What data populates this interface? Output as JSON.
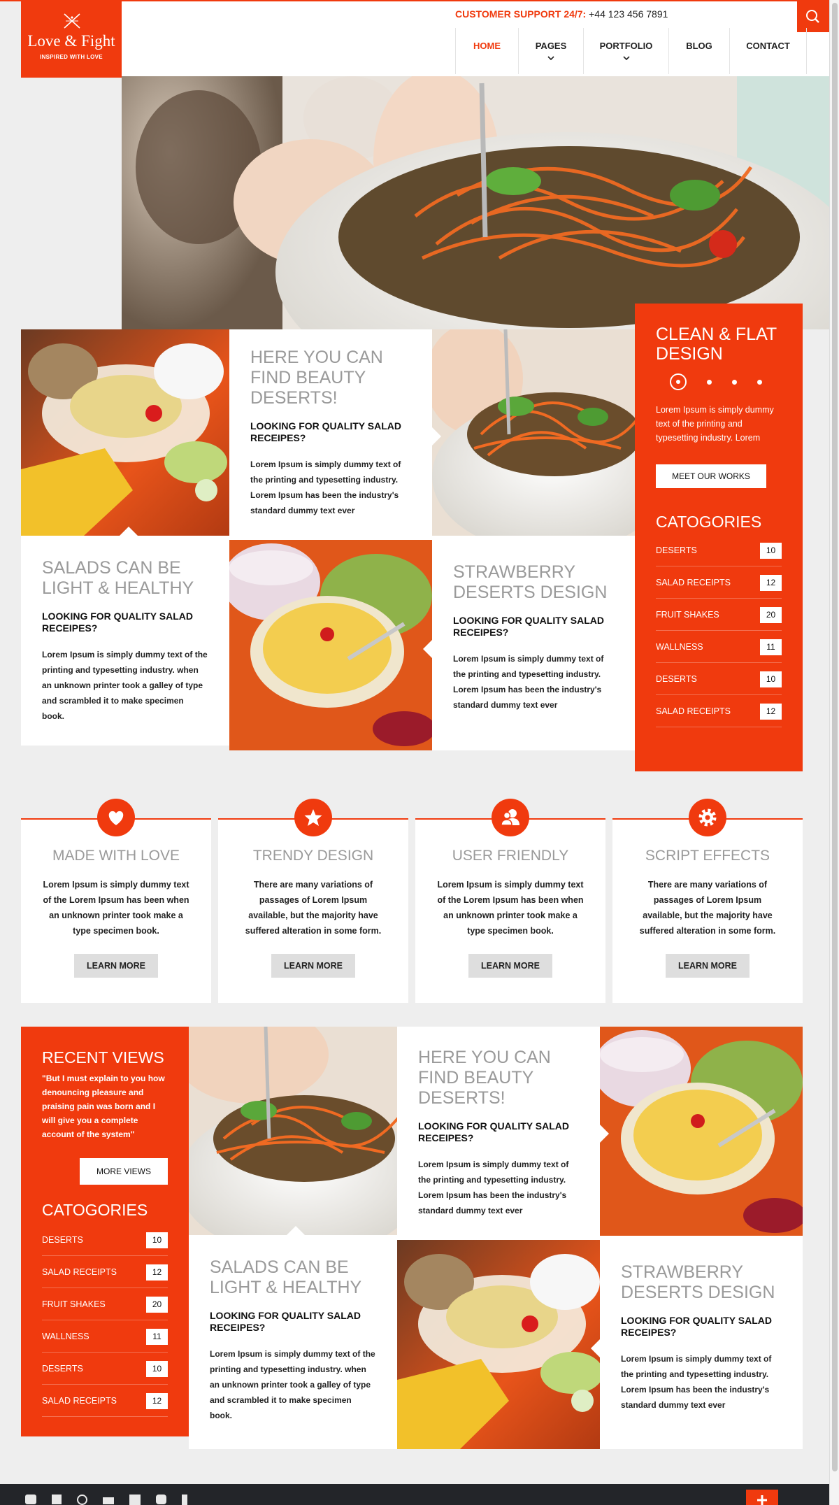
{
  "header": {
    "logo": {
      "name": "Love & Fight",
      "tagline": "INSPIRED WITH LOVE"
    },
    "support": {
      "label": "CUSTOMER SUPPORT 24/7:",
      "phone": "+44 123 456 7891"
    },
    "nav": [
      {
        "label": "HOME",
        "active": true,
        "dropdown": false
      },
      {
        "label": "PAGES",
        "active": false,
        "dropdown": true
      },
      {
        "label": "PORTFOLIO",
        "active": false,
        "dropdown": true
      },
      {
        "label": "BLOG",
        "active": false,
        "dropdown": false
      },
      {
        "label": "CONTACT",
        "active": false,
        "dropdown": false
      }
    ],
    "search_icon": "search-icon"
  },
  "grid1": {
    "beauty": {
      "heading": "HERE YOU CAN FIND BEAUTY DESERTS!",
      "sub": "LOOKING FOR QUALITY SALAD RECEIPES?",
      "body": "Lorem Ipsum is simply dummy text of the printing and typesetting industry. Lorem Ipsum has been the industry's standard dummy text ever"
    },
    "salads": {
      "heading": "SALADS CAN BE LIGHT & HEALTHY",
      "sub": "LOOKING FOR QUALITY SALAD RECEIPES?",
      "body": "Lorem Ipsum is simply dummy text of the printing and typesetting industry. when an unknown printer took a galley of type and scrambled it to make specimen book."
    },
    "strawberry": {
      "heading": "STRAWBERRY DESERTS DESIGN",
      "sub": "LOOKING FOR QUALITY SALAD RECEIPES?",
      "body": "Lorem Ipsum is simply dummy text of the printing and typesetting industry. Lorem Ipsum has been the industry's standard dummy text ever"
    }
  },
  "slider_panel": {
    "title": "CLEAN & FLAT DESIGN",
    "text": "Lorem Ipsum is simply dummy text of the printing and typesetting industry. Lorem Ipsum has been the industry's",
    "button": "MEET OUR WORKS",
    "categories_title": "CATOGORIES",
    "categories": [
      {
        "label": "DESERTS",
        "count": "10"
      },
      {
        "label": "SALAD RECEIPTS",
        "count": "12"
      },
      {
        "label": "FRUIT SHAKES",
        "count": "20"
      },
      {
        "label": "WALLNESS",
        "count": "11"
      },
      {
        "label": "DESERTS",
        "count": "10"
      },
      {
        "label": "SALAD RECEIPTS",
        "count": "12"
      }
    ]
  },
  "features": [
    {
      "icon": "heart-icon",
      "title": "MADE WITH LOVE",
      "text": "Lorem Ipsum is simply dummy text of the Lorem Ipsum has been when an unknown printer took make a type specimen book.",
      "button": "LEARN MORE"
    },
    {
      "icon": "star-icon",
      "title": "TRENDY DESIGN",
      "text": "There are many variations of passages of Lorem Ipsum available, but the majority have suffered alteration in some form.",
      "button": "LEARN MORE"
    },
    {
      "icon": "users-icon",
      "title": "USER FRIENDLY",
      "text": "Lorem Ipsum is simply dummy text of the Lorem Ipsum has been when an unknown printer took make a type specimen book.",
      "button": "LEARN MORE"
    },
    {
      "icon": "gear-icon",
      "title": "SCRIPT EFFECTS",
      "text": "There are many variations of passages of Lorem Ipsum available, but the majority have suffered alteration in some form.",
      "button": "LEARN MORE"
    }
  ],
  "recent_panel": {
    "title": "RECENT VIEWS",
    "quote": "\"But I must explain to you how denouncing pleasure and praising pain was born and I will give you a complete account of the system\"",
    "button": "MORE VIEWS",
    "categories_title": "CATOGORIES",
    "categories": [
      {
        "label": "DESERTS",
        "count": "10"
      },
      {
        "label": "SALAD RECEIPTS",
        "count": "12"
      },
      {
        "label": "FRUIT SHAKES",
        "count": "20"
      },
      {
        "label": "WALLNESS",
        "count": "11"
      },
      {
        "label": "DESERTS",
        "count": "10"
      },
      {
        "label": "SALAD RECEIPTS",
        "count": "12"
      }
    ]
  },
  "grid2": {
    "beauty": {
      "heading": "HERE YOU CAN FIND BEAUTY DESERTS!",
      "sub": "LOOKING FOR QUALITY SALAD RECEIPES?",
      "body": "Lorem Ipsum is simply dummy text of the printing and typesetting industry. Lorem Ipsum has been the industry's standard dummy text ever"
    },
    "salads": {
      "heading": "SALADS CAN BE LIGHT & HEALTHY",
      "sub": "LOOKING FOR QUALITY SALAD RECEIPES?",
      "body": "Lorem Ipsum is simply dummy text of the printing and typesetting industry. when an unknown printer took a galley of type and scrambled it to make specimen book."
    },
    "strawberry": {
      "heading": "STRAWBERRY DESERTS DESIGN",
      "sub": "LOOKING FOR QUALITY SALAD RECEIPES?",
      "body": "Lorem Ipsum is simply dummy text of the printing and typesetting industry. Lorem Ipsum has been the industry's standard dummy text ever"
    }
  },
  "footer": {
    "social_icons": [
      "twitter-icon",
      "linkedin-icon",
      "dribbble-icon",
      "flickr-icon",
      "youtube-icon",
      "vimeo-icon",
      "facebook-icon"
    ],
    "plus_icon": "plus-icon"
  },
  "colors": {
    "accent": "#f03a0e",
    "page_bg": "#eeeeee",
    "heading_gray": "#9a9a9a"
  }
}
